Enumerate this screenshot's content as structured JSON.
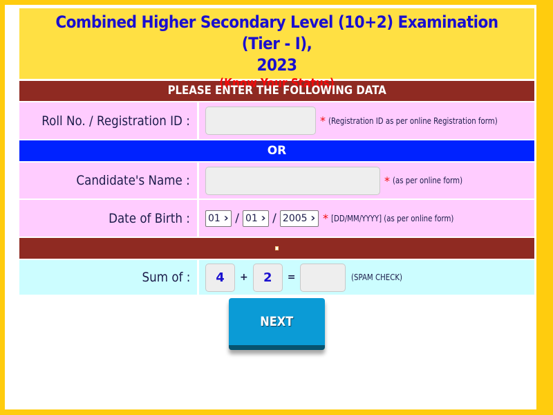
{
  "header": {
    "title_line1": "Combined Higher Secondary Level (10+2) Examination (Tier - I),",
    "title_line2": "2023",
    "subtitle": "(Know Your Status)"
  },
  "instruction_bar": "PLEASE ENTER THE FOLLOWING DATA",
  "or_bar": "OR",
  "fields": {
    "roll": {
      "label": "Roll No. / Registration ID :",
      "value": "",
      "required_mark": "*",
      "hint": "(Registration ID as per online Registration form)"
    },
    "name": {
      "label": "Candidate's Name :",
      "value": "",
      "required_mark": "*",
      "hint": "(as per online form)"
    },
    "dob": {
      "label": "Date of Birth :",
      "day": "01",
      "month": "01",
      "year": "2005",
      "separator": "/",
      "required_mark": "*",
      "hint": "[DD/MM/YYYY] (as per online form)"
    }
  },
  "captcha": {
    "label": "Sum of :",
    "a": "4",
    "operator": "+",
    "b": "2",
    "equals": "=",
    "answer": "",
    "hint": "(SPAM CHECK)"
  },
  "next_button": "NEXT",
  "colors": {
    "frame": "#ffcc0e",
    "header_bg": "#ffe043",
    "title": "#1a0fcf",
    "subtitle": "#f20a0a",
    "maroon_bar": "#8f2a22",
    "blue_bar": "#0022ff",
    "pink_row": "#ffccff",
    "cyan_row": "#ccfdff",
    "button": "#0b9bd6"
  }
}
